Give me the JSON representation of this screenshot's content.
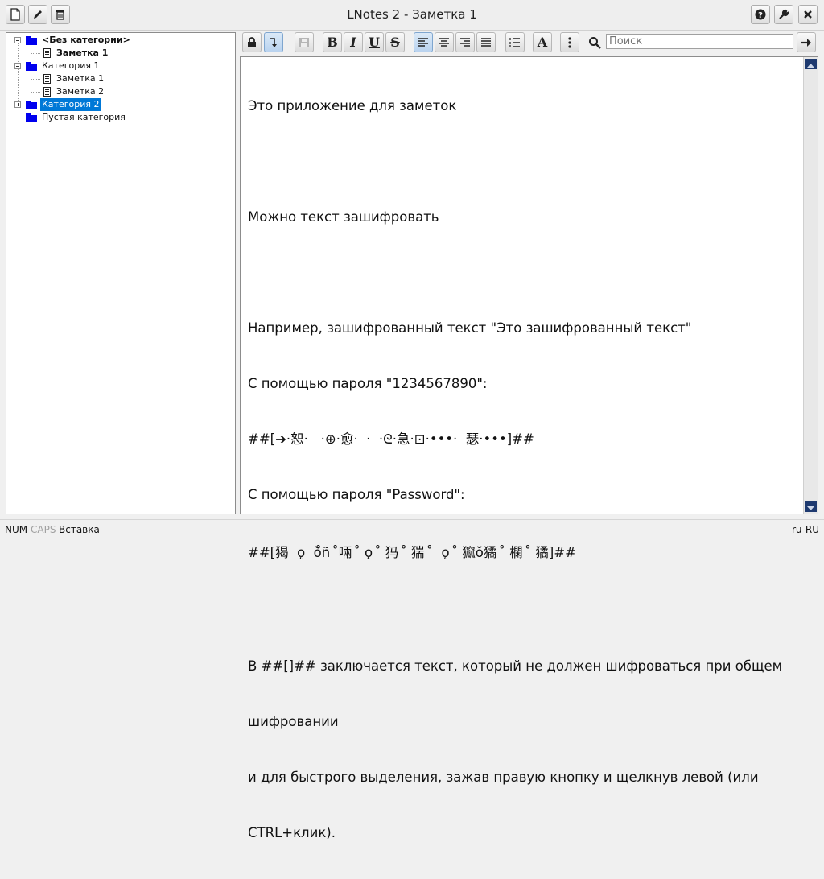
{
  "window": {
    "title": "LNotes 2 - Заметка 1",
    "left_buttons": [
      "new-note-icon",
      "edit-icon",
      "trash-icon"
    ],
    "right_buttons": [
      "help-icon",
      "wrench-icon",
      "close-icon"
    ]
  },
  "tree": {
    "items": [
      {
        "label": "<Без категории>",
        "type": "category",
        "bold": true,
        "expanded": true
      },
      {
        "label": "Заметка 1",
        "type": "note",
        "bold": true
      },
      {
        "label": "Категория 1",
        "type": "category",
        "expanded": true
      },
      {
        "label": "Заметка 1",
        "type": "note"
      },
      {
        "label": "Заметка 2",
        "type": "note"
      },
      {
        "label": "Категория 2",
        "type": "category",
        "selected": true,
        "expanded": false
      },
      {
        "label": "Пустая категория",
        "type": "category"
      }
    ]
  },
  "toolbar": {
    "bold_label": "B",
    "italic_label": "I",
    "underline_label": "U",
    "strike_label": "S",
    "font_label": "A",
    "search_placeholder": "Поиск",
    "accent": "#0000ee"
  },
  "editor": {
    "lines": [
      "Это приложение для заметок",
      "",
      "Можно текст зашифровать",
      "",
      "Например, зашифрованный текст \"Это зашифрованный текст\"",
      "С помощью пароля \"1234567890\":",
      "##[➔·恕·   ·⊕·愈·  ·  ·ᘓ·急·⊡·•••·  瑟·•••]##",
      "С помощью пароля \"Password\":",
      "##[猲  ǫ  ŏ̊ñ  ̊啢  ̊ ǫ  ̊ 犸  ̊ 猯  ̊  ǫ  ̊ 㺠ŏ獝  ̊ 㯗  ̊ 獝]##",
      "",
      "В ##[]## заключается текст, который не должен шифроваться при общем",
      "шифровании",
      "и для быстрого выделения, зажав правую кнопку и щелкнув левой (или",
      "CTRL+клик)."
    ]
  },
  "status": {
    "num": "NUM",
    "caps": "CAPS",
    "insert": "Вставка",
    "locale": "ru-RU"
  }
}
